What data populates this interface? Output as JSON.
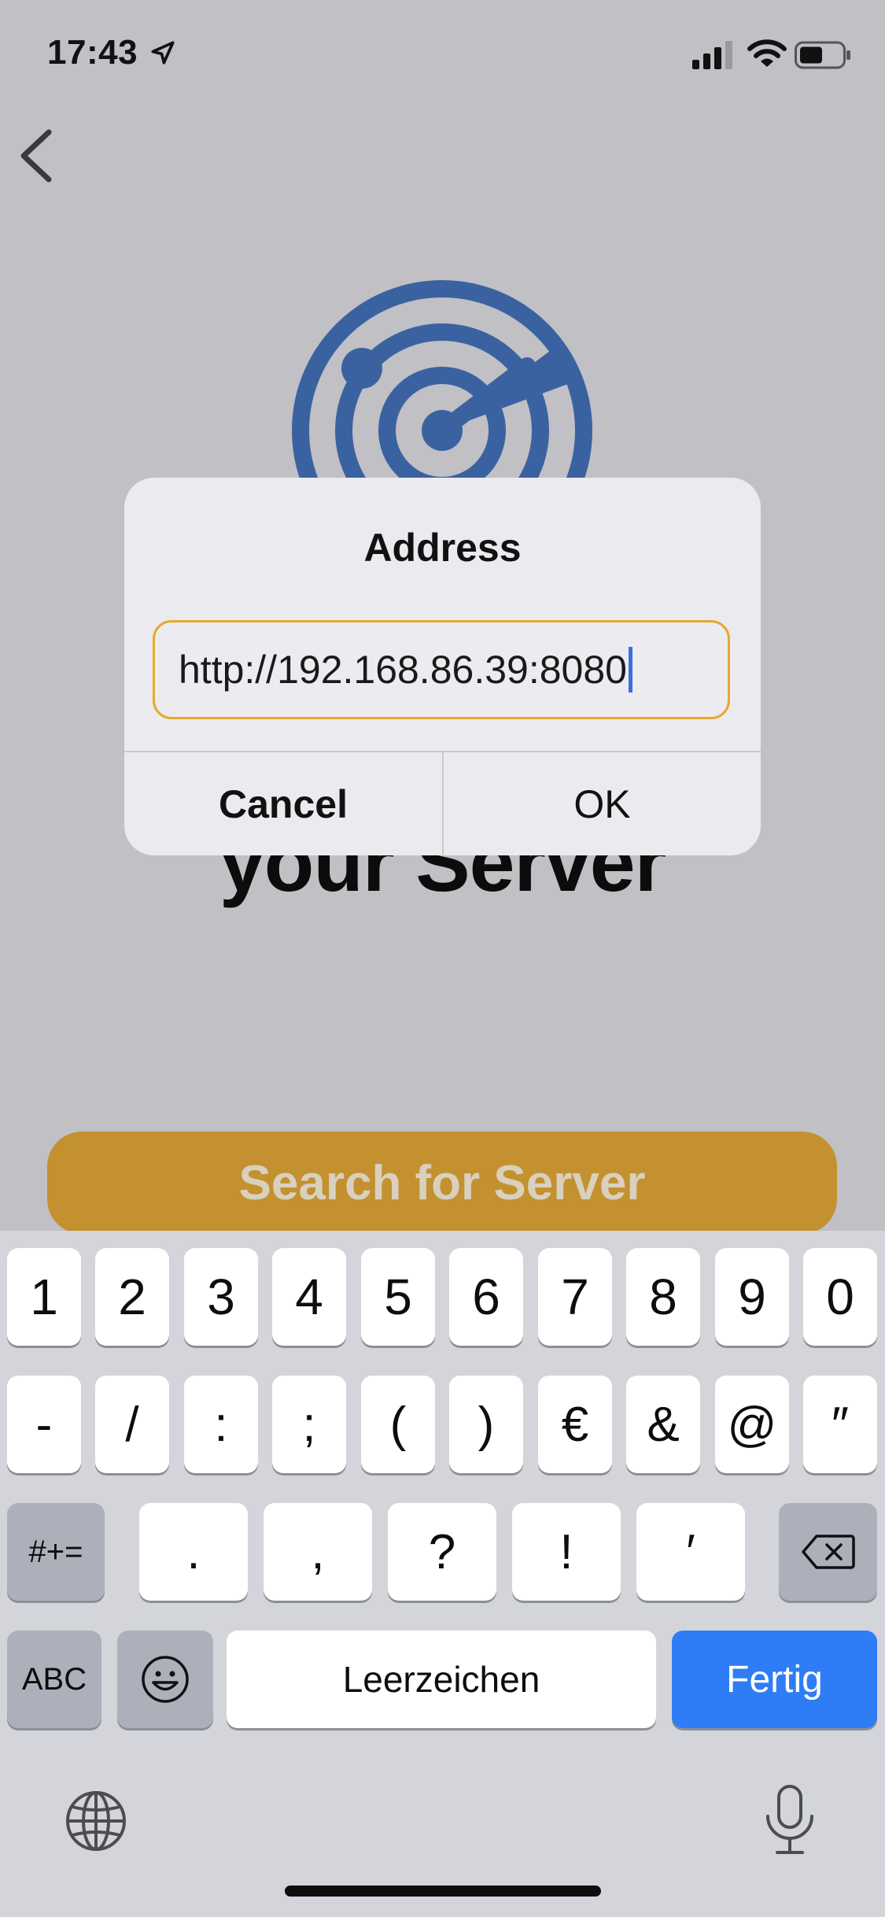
{
  "status_bar": {
    "time": "17:43"
  },
  "background": {
    "headline": "your Server",
    "search_button": "Search for Server"
  },
  "alert": {
    "title": "Address",
    "field_value": "http://192.168.86.39:8080",
    "cancel_label": "Cancel",
    "ok_label": "OK"
  },
  "keyboard": {
    "row1": [
      "1",
      "2",
      "3",
      "4",
      "5",
      "6",
      "7",
      "8",
      "9",
      "0"
    ],
    "row2": [
      "-",
      "/",
      ":",
      ";",
      "(",
      ")",
      "€",
      "&",
      "@",
      "″"
    ],
    "row3": [
      ".",
      ",",
      "?",
      "!",
      "′"
    ],
    "symbols_key": "#+=",
    "abc_key": "ABC",
    "space_label": "Leerzeichen",
    "return_label": "Fertig"
  },
  "colors": {
    "accent": "#c3912f",
    "field_border": "#e6a92d",
    "return_key": "#2f7df6",
    "radar": "#3b62a0"
  },
  "icons": [
    "location-arrow-icon",
    "cellular-signal-icon",
    "wifi-icon",
    "battery-icon",
    "back-chevron-icon",
    "radar-icon",
    "delete-icon",
    "emoji-icon",
    "globe-icon",
    "microphone-icon"
  ]
}
